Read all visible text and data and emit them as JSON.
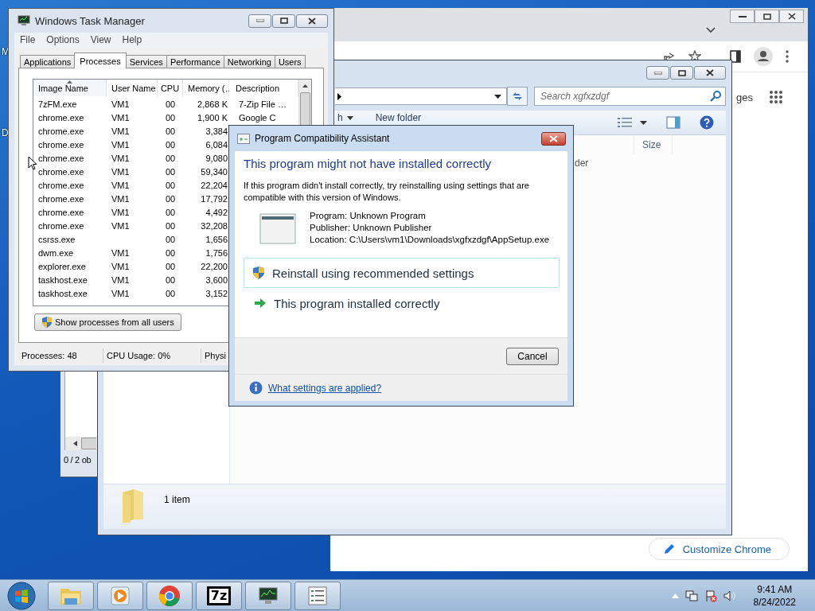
{
  "desktop": {
    "icon_labels": [
      "M",
      "D"
    ]
  },
  "browser": {
    "page_text": "ges",
    "customize_button": "Customize Chrome"
  },
  "background_window": {
    "status": "0 / 2 ob"
  },
  "explorer": {
    "search_placeholder": "Search xgfxzdgf",
    "toolbar_menu": "h",
    "new_folder": "New folder",
    "column_header": "Size",
    "item_text": "der",
    "details": "1 item"
  },
  "task_manager": {
    "title": "Windows Task Manager",
    "menu": [
      "File",
      "Options",
      "View",
      "Help"
    ],
    "tabs": [
      {
        "label": "Applications",
        "selected": false
      },
      {
        "label": "Processes",
        "selected": true
      },
      {
        "label": "Services",
        "selected": false
      },
      {
        "label": "Performance",
        "selected": false
      },
      {
        "label": "Networking",
        "selected": false
      },
      {
        "label": "Users",
        "selected": false
      }
    ],
    "columns": [
      {
        "label": "Image Name",
        "sorted": true
      },
      {
        "label": "User Name",
        "sorted": false
      },
      {
        "label": "CPU",
        "sorted": false
      },
      {
        "label": "Memory (…",
        "sorted": false
      },
      {
        "label": "Description",
        "sorted": false
      }
    ],
    "rows": [
      {
        "image_name": "7zFM.exe",
        "user_name": "VM1",
        "cpu": "00",
        "memory": "2,868 K",
        "description": "7-Zip File …"
      },
      {
        "image_name": "chrome.exe",
        "user_name": "VM1",
        "cpu": "00",
        "memory": "1,900 K",
        "description": "Google C"
      },
      {
        "image_name": "chrome.exe",
        "user_name": "VM1",
        "cpu": "00",
        "memory": "3,384"
      },
      {
        "image_name": "chrome.exe",
        "user_name": "VM1",
        "cpu": "00",
        "memory": "6,084"
      },
      {
        "image_name": "chrome.exe",
        "user_name": "VM1",
        "cpu": "00",
        "memory": "9,080"
      },
      {
        "image_name": "chrome.exe",
        "user_name": "VM1",
        "cpu": "00",
        "memory": "59,340"
      },
      {
        "image_name": "chrome.exe",
        "user_name": "VM1",
        "cpu": "00",
        "memory": "22,204"
      },
      {
        "image_name": "chrome.exe",
        "user_name": "VM1",
        "cpu": "00",
        "memory": "17,792"
      },
      {
        "image_name": "chrome.exe",
        "user_name": "VM1",
        "cpu": "00",
        "memory": "4,492"
      },
      {
        "image_name": "chrome.exe",
        "user_name": "VM1",
        "cpu": "00",
        "memory": "32,208"
      },
      {
        "image_name": "csrss.exe",
        "cpu": "00",
        "memory": "1,656"
      },
      {
        "image_name": "dwm.exe",
        "user_name": "VM1",
        "cpu": "00",
        "memory": "1,756"
      },
      {
        "image_name": "explorer.exe",
        "user_name": "VM1",
        "cpu": "00",
        "memory": "22,200"
      },
      {
        "image_name": "taskhost.exe",
        "user_name": "VM1",
        "cpu": "00",
        "memory": "3,600"
      },
      {
        "image_name": "taskhost.exe",
        "user_name": "VM1",
        "cpu": "00",
        "memory": "3,152"
      }
    ],
    "show_all_button": "Show processes from all users",
    "status": [
      "Processes: 48",
      "CPU Usage: 0%",
      "Physi"
    ]
  },
  "dialog": {
    "title": "Program Compatibility Assistant",
    "heading": "This program might not have installed correctly",
    "body": "If this program didn't install correctly, try reinstalling using settings that are compatible with this version of Windows.",
    "details": [
      "Program: Unknown Program",
      "Publisher: Unknown Publisher",
      "Location: C:\\Users\\vm1\\Downloads\\xgfxzdgf\\AppSetup.exe"
    ],
    "options": [
      {
        "kind": "shield",
        "label": "Reinstall using recommended settings",
        "selected": true
      },
      {
        "kind": "arrow",
        "label": "This program installed correctly",
        "selected": false
      }
    ],
    "cancel": "Cancel",
    "help_link": "What settings are applied?"
  },
  "taskbar": {
    "apps": [
      {
        "kind": "folder"
      },
      {
        "kind": "media"
      },
      {
        "kind": "chrome"
      },
      {
        "kind": "sevenzip",
        "label": "7z"
      },
      {
        "kind": "monitor"
      },
      {
        "kind": "list"
      }
    ],
    "time": "9:41 AM",
    "date": "8/24/2022"
  }
}
